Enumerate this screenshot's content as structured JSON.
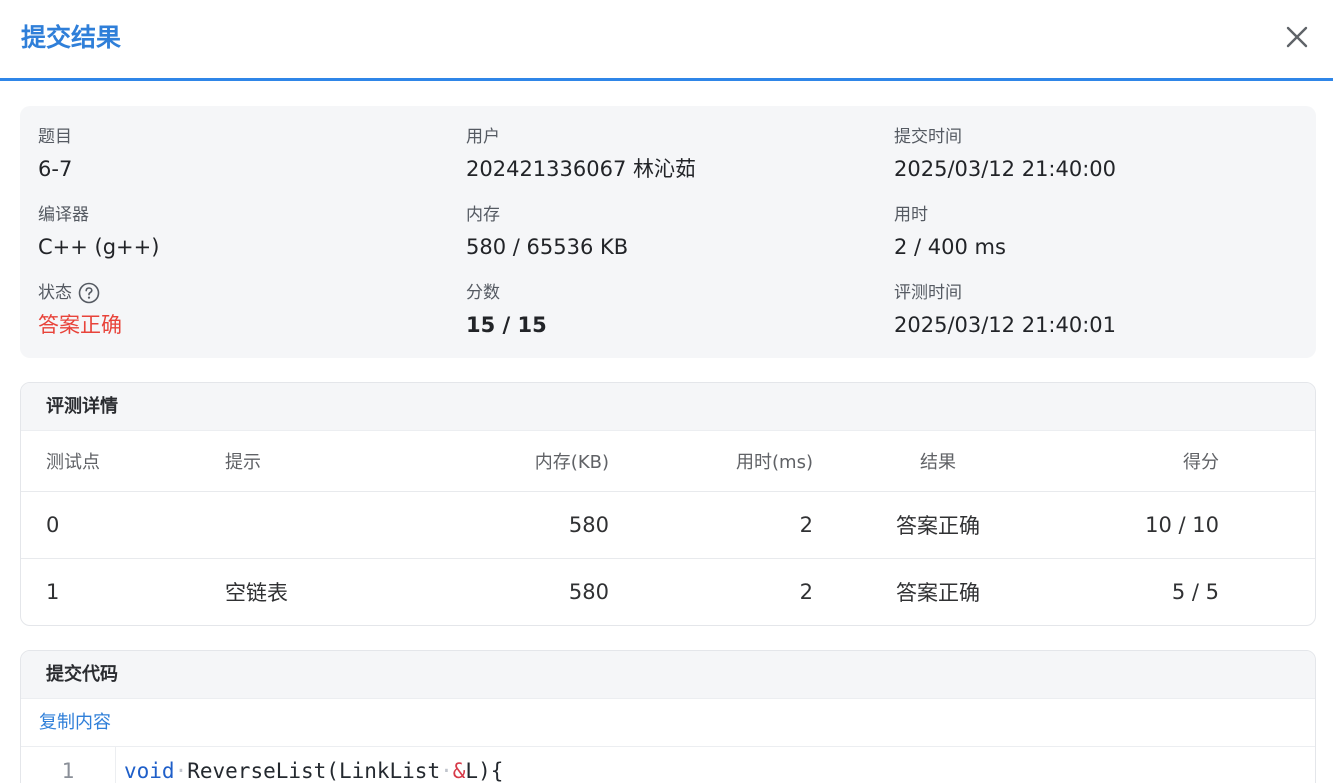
{
  "dialog": {
    "title": "提交结果"
  },
  "info": {
    "problem_label": "题目",
    "problem_value": "6-7",
    "user_label": "用户",
    "user_value": "202421336067 林沁茹",
    "submit_time_label": "提交时间",
    "submit_time_value": "2025/03/12 21:40:00",
    "compiler_label": "编译器",
    "compiler_value": "C++ (g++)",
    "memory_label": "内存",
    "memory_value": "580 / 65536 KB",
    "time_label": "用时",
    "time_value": "2 / 400 ms",
    "status_label": "状态",
    "status_value": "答案正确",
    "score_label": "分数",
    "score_value": "15 / 15",
    "judge_time_label": "评测时间",
    "judge_time_value": "2025/03/12 21:40:01"
  },
  "judge": {
    "title": "评测详情",
    "columns": [
      "测试点",
      "提示",
      "内存(KB)",
      "用时(ms)",
      "结果",
      "得分"
    ],
    "rows": [
      [
        "0",
        "",
        "580",
        "2",
        "答案正确",
        "10 / 10"
      ],
      [
        "1",
        "空链表",
        "580",
        "2",
        "答案正确",
        "5 / 5"
      ]
    ]
  },
  "code": {
    "title": "提交代码",
    "copy_label": "复制内容",
    "line_number": "1",
    "tokens": {
      "keyword": "void",
      "dot1": "·",
      "func": "ReverseList(LinkList",
      "dot2": "·",
      "amp": "&",
      "rest": "L){"
    }
  },
  "colors": {
    "accent": "#2f86e8",
    "accepted": "#e8433a",
    "panel_bg": "#f5f6f8"
  },
  "icons": {
    "close": "close-icon",
    "help": "question-circle-icon"
  }
}
